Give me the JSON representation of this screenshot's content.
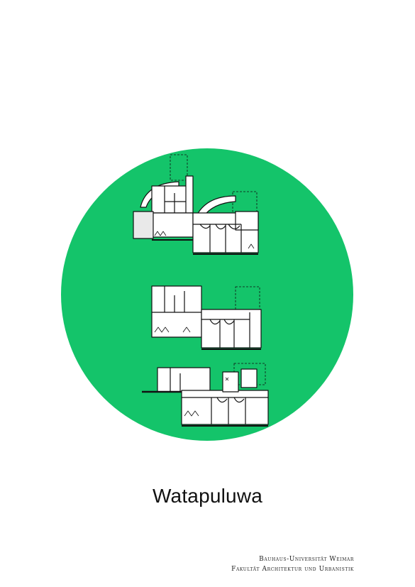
{
  "title": "Watapuluwa",
  "credits": {
    "line1": "Bauhaus-Universität Weimar",
    "line2": "Fakultät Architektur und Urbanistik"
  },
  "colors": {
    "background": "#ffffff",
    "circle": "#14c46a",
    "ink": "#111111"
  },
  "drawings": {
    "plan_count": 3,
    "style": "hand-drawn floor plans"
  }
}
